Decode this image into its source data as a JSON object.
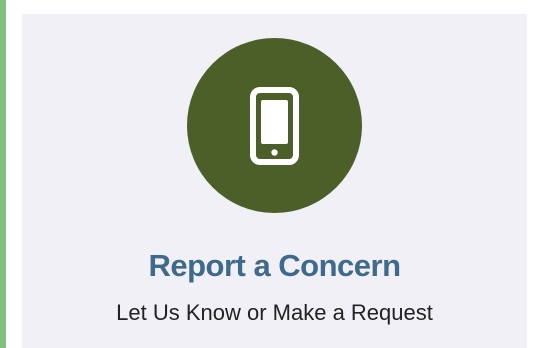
{
  "card": {
    "icon": "mobile-phone-icon",
    "title": "Report a Concern",
    "subtitle": "Let Us Know or Make a Request"
  },
  "colors": {
    "accent_bar": "#7fc17a",
    "card_background": "#f1f0f6",
    "icon_circle": "#4c5f29",
    "title": "#3e6a8c",
    "subtitle": "#222222"
  }
}
